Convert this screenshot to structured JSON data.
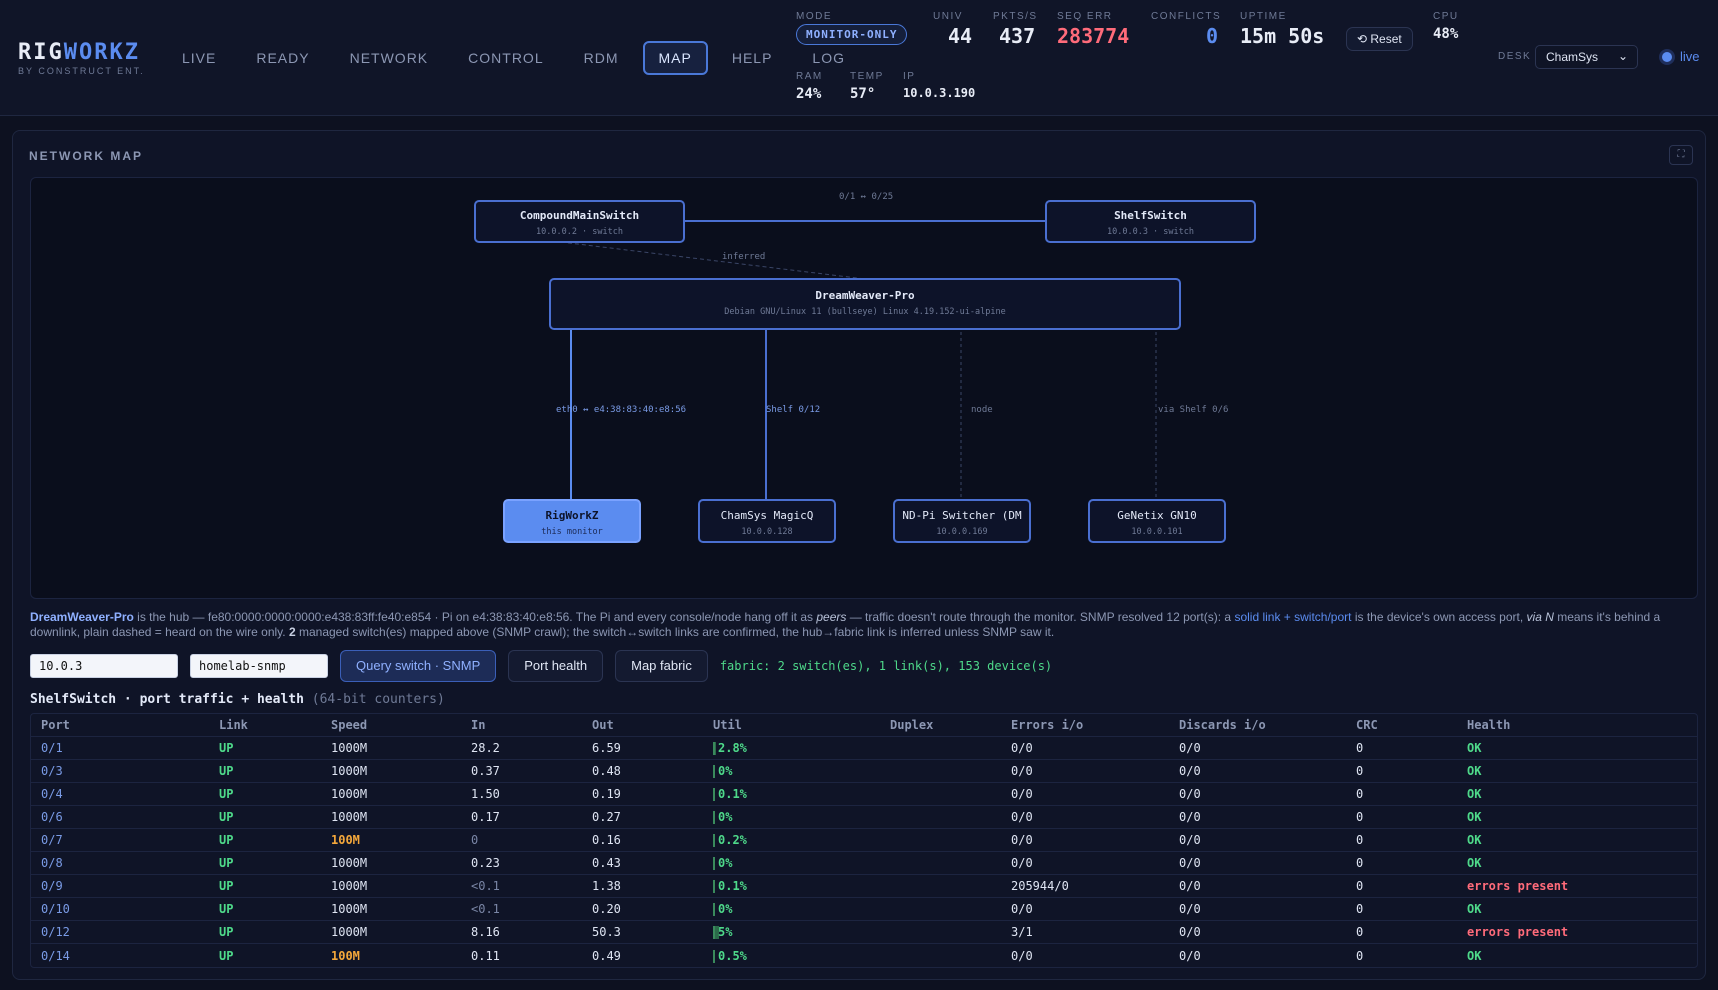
{
  "brand": {
    "name_a": "RIG",
    "name_b": "WORKZ",
    "sub": "BY CONSTRUCT ENT."
  },
  "nav": [
    "LIVE",
    "READY",
    "NETWORK",
    "CONTROL",
    "RDM",
    "MAP",
    "HELP",
    "LOG"
  ],
  "nav_active": "MAP",
  "stats": {
    "mode_label": "MODE",
    "mode_value": "MONITOR-ONLY",
    "univ_label": "UNIV",
    "univ_value": "44",
    "pkts_label": "PKTS/S",
    "pkts_value": "437",
    "seqerr_label": "SEQ ERR",
    "seqerr_value": "283774",
    "conflicts_label": "CONFLICTS",
    "conflicts_value": "0",
    "uptime_label": "UPTIME",
    "uptime_value": "15m 50s",
    "reset_label": "⟲ Reset",
    "cpu_label": "CPU",
    "cpu_value": "48%",
    "ram_label": "RAM",
    "ram_value": "24%",
    "temp_label": "TEMP",
    "temp_value": "57°",
    "ip_label": "IP",
    "ip_value": "10.0.3.190"
  },
  "desk": {
    "label": "DESK",
    "value": "ChamSys"
  },
  "live_label": "live",
  "colors": {
    "accent": "#5b8cf0",
    "bg": "#0d1120",
    "ok": "#4ed98a",
    "error": "#ff6b7a",
    "warn": "#f5a83b"
  },
  "panel": {
    "title": "NETWORK MAP"
  },
  "map": {
    "nodes": {
      "compound": {
        "title": "CompoundMainSwitch",
        "sub": "10.0.0.2 · switch"
      },
      "shelf": {
        "title": "ShelfSwitch",
        "sub": "10.0.0.3 · switch"
      },
      "hub": {
        "title": "DreamWeaver-Pro",
        "sub": "Debian GNU/Linux 11 (bullseye) Linux 4.19.152-ui-alpine"
      },
      "rigworkz": {
        "title": "RigWorkZ",
        "sub": "this monitor"
      },
      "chamsys": {
        "title": "ChamSys MagicQ",
        "sub": "10.0.0.128"
      },
      "ndpi": {
        "title": "ND-Pi Switcher (DM",
        "sub": "10.0.0.169"
      },
      "genetix": {
        "title": "GeNetix GN10",
        "sub": "10.0.0.101"
      }
    },
    "edges": {
      "switch_link": "0/1 ↔ 0/25",
      "inferred": "inferred",
      "eth0": "eth0 ↔ e4:38:83:40:e8:56",
      "shelf_012": "Shelf 0/12",
      "node": "node",
      "via_shelf": "via Shelf 0/6"
    }
  },
  "explain": {
    "hub": "DreamWeaver-Pro",
    "t1": " is the hub — fe80:0000:0000:0000:e438:83ff:fe40:e854 · Pi on e4:38:83:40:e8:56. The Pi and every console/node hang off it as ",
    "peers": "peers",
    "t2": " — traffic doesn't route through the monitor. SNMP resolved 12 port(s): a ",
    "solid": "solid link + switch/port",
    "t3": " is the device's own access port, ",
    "vian": "via N",
    "t4": " means it's behind a downlink, plain dashed = heard on the wire only. ",
    "count": "2",
    "t5": " managed switch(es) mapped above (SNMP crawl); the switch↔switch links are confirmed, the hub→fabric link is inferred unless SNMP saw it."
  },
  "controls": {
    "host_value": "10.0.3",
    "community_value": "homelab-snmp",
    "query_label": "Query switch · SNMP",
    "health_label": "Port health",
    "fabric_label": "Map fabric",
    "fabric_status": "fabric: 2 switch(es), 1 link(s), 153 device(s)"
  },
  "table": {
    "title": "ShelfSwitch · port traffic + health",
    "title_note": "(64-bit counters)",
    "headers": [
      "Port",
      "Link",
      "Speed",
      "In",
      "Out",
      "Util",
      "Duplex",
      "Errors i/o",
      "Discards i/o",
      "CRC",
      "Health"
    ],
    "rows": [
      {
        "port": "0/1",
        "link": "UP",
        "speed": "1000M",
        "in": "28.2",
        "out": "6.59",
        "util": "2.8%",
        "util_frac": 0.028,
        "duplex": "",
        "errors": "0/0",
        "discards": "0/0",
        "crc": "0",
        "health": "OK"
      },
      {
        "port": "0/3",
        "link": "UP",
        "speed": "1000M",
        "in": "0.37",
        "out": "0.48",
        "util": "0%",
        "util_frac": 0,
        "duplex": "",
        "errors": "0/0",
        "discards": "0/0",
        "crc": "0",
        "health": "OK"
      },
      {
        "port": "0/4",
        "link": "UP",
        "speed": "1000M",
        "in": "1.50",
        "out": "0.19",
        "util": "0.1%",
        "util_frac": 0.001,
        "duplex": "",
        "errors": "0/0",
        "discards": "0/0",
        "crc": "0",
        "health": "OK"
      },
      {
        "port": "0/6",
        "link": "UP",
        "speed": "1000M",
        "in": "0.17",
        "out": "0.27",
        "util": "0%",
        "util_frac": 0,
        "duplex": "",
        "errors": "0/0",
        "discards": "0/0",
        "crc": "0",
        "health": "OK"
      },
      {
        "port": "0/7",
        "link": "UP",
        "speed": "100M",
        "in": "0",
        "out": "0.16",
        "util": "0.2%",
        "util_frac": 0.002,
        "duplex": "",
        "errors": "0/0",
        "discards": "0/0",
        "crc": "0",
        "health": "OK"
      },
      {
        "port": "0/8",
        "link": "UP",
        "speed": "1000M",
        "in": "0.23",
        "out": "0.43",
        "util": "0%",
        "util_frac": 0,
        "duplex": "",
        "errors": "0/0",
        "discards": "0/0",
        "crc": "0",
        "health": "OK"
      },
      {
        "port": "0/9",
        "link": "UP",
        "speed": "1000M",
        "in": "<0.1",
        "out": "1.38",
        "util": "0.1%",
        "util_frac": 0.001,
        "duplex": "",
        "errors": "205944/0",
        "discards": "0/0",
        "crc": "0",
        "health": "errors present"
      },
      {
        "port": "0/10",
        "link": "UP",
        "speed": "1000M",
        "in": "<0.1",
        "out": "0.20",
        "util": "0%",
        "util_frac": 0,
        "duplex": "",
        "errors": "0/0",
        "discards": "0/0",
        "crc": "0",
        "health": "OK"
      },
      {
        "port": "0/12",
        "link": "UP",
        "speed": "1000M",
        "in": "8.16",
        "out": "50.3",
        "util": "5%",
        "util_frac": 0.05,
        "duplex": "",
        "errors": "3/1",
        "discards": "0/0",
        "crc": "0",
        "health": "errors present"
      },
      {
        "port": "0/14",
        "link": "UP",
        "speed": "100M",
        "in": "0.11",
        "out": "0.49",
        "util": "0.5%",
        "util_frac": 0.005,
        "duplex": "",
        "errors": "0/0",
        "discards": "0/0",
        "crc": "0",
        "health": "OK"
      }
    ]
  }
}
